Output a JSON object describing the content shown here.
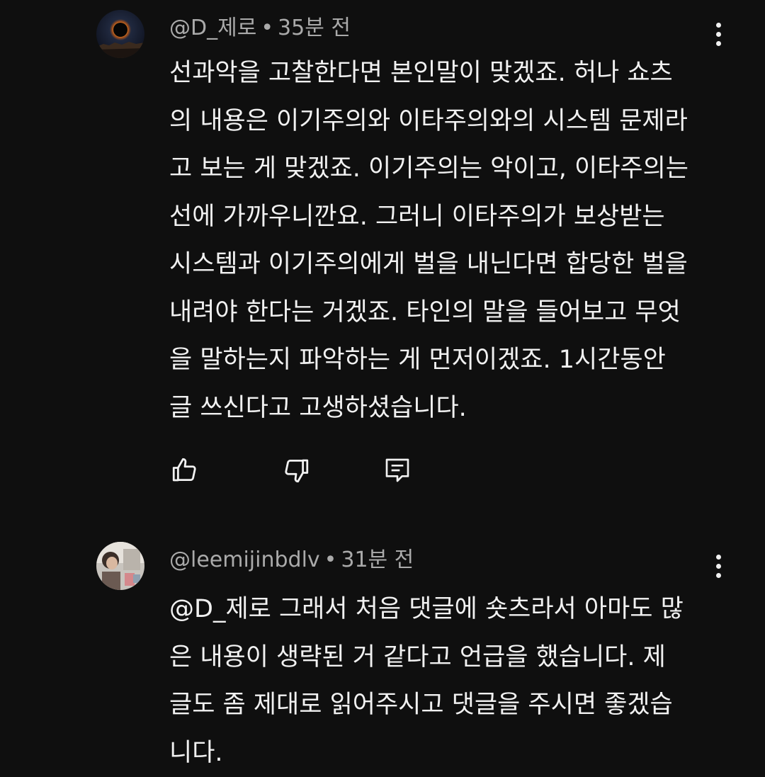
{
  "comments": [
    {
      "author": "@D_제로",
      "separator": "•",
      "time": "35분 전",
      "avatar_icon": "eclipse-avatar",
      "body_lines": [
        "선과악을 고찰한다면 본인말이 맞겠죠. 허나 쇼츠",
        "의 내용은 이기주의와 이타주의와의 시스템 문제라",
        "고 보는 게 맞겠죠. 이기주의는 악이고, 이타주의는",
        "선에 가까우니깐요. 그러니 이타주의가 보상받는",
        "시스템과 이기주의에게 벌을 내닌다면 합당한 벌을",
        "내려야 한다는 거겠죠. 타인의 말을 들어보고 무엇",
        "을 말하는지 파악하는 게 먼저이겠죠. 1시간동안",
        "글 쓰신다고 고생하셨습니다."
      ],
      "actions": {
        "like_icon": "thumbs-up-icon",
        "dislike_icon": "thumbs-down-icon",
        "reply_icon": "reply-comment-icon"
      }
    },
    {
      "author": "@leemijinbdlv",
      "separator": "•",
      "time": "31분 전",
      "avatar_icon": "photo-avatar",
      "body_lines": [
        "@D_제로 그래서 처음 댓글에 숏츠라서 아마도 많",
        "은 내용이 생략된 거 같다고 언급을 했습니다. 제",
        "글도 좀 제대로 읽어주시고 댓글을 주시면 좋겠습",
        "니다."
      ]
    }
  ],
  "colors": {
    "background": "#0f0f0f",
    "text": "#f1f1f1",
    "meta": "#aaaaaa"
  }
}
